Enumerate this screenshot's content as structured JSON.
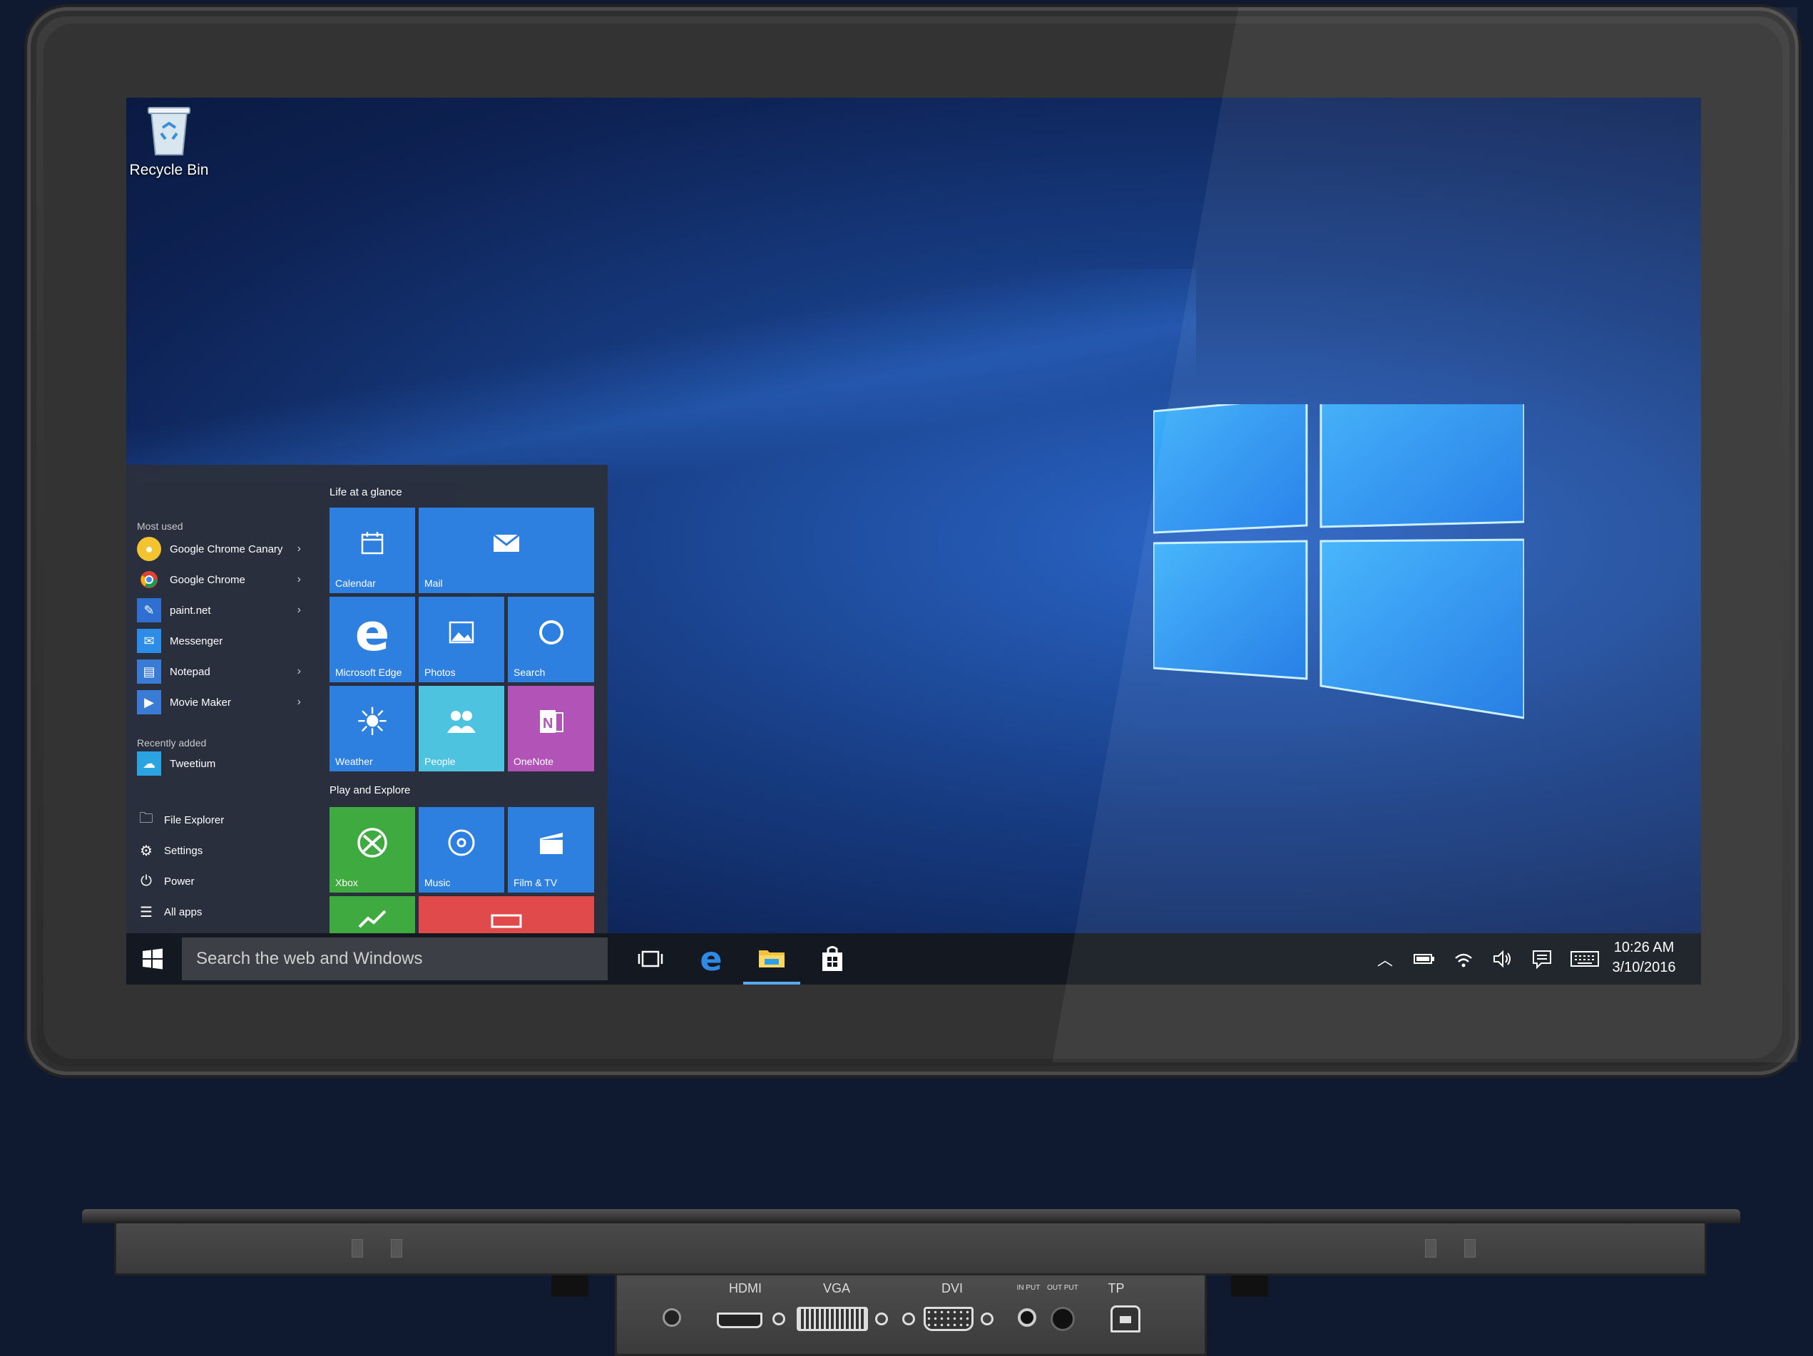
{
  "desktop": {
    "recycle_bin_label": "Recycle Bin"
  },
  "start_menu": {
    "most_used_header": "Most used",
    "most_used": [
      {
        "label": "Google Chrome Canary",
        "icon": "chrome-canary-icon",
        "color": "#f4c430",
        "has_submenu": true
      },
      {
        "label": "Google Chrome",
        "icon": "chrome-icon",
        "color": "#4c8bf5",
        "has_submenu": true
      },
      {
        "label": "paint.net",
        "icon": "paintnet-icon",
        "color": "#2f6fd1",
        "has_submenu": true
      },
      {
        "label": "Messenger",
        "icon": "messenger-icon",
        "color": "#2d8ce8",
        "has_submenu": false
      },
      {
        "label": "Notepad",
        "icon": "notepad-icon",
        "color": "#3a7bd5",
        "has_submenu": true
      },
      {
        "label": "Movie Maker",
        "icon": "movie-maker-icon",
        "color": "#3a7bd5",
        "has_submenu": true
      }
    ],
    "recently_added_header": "Recently added",
    "recently_added": [
      {
        "label": "Tweetium",
        "icon": "tweetium-icon",
        "color": "#2aa3e0"
      }
    ],
    "system_items": [
      {
        "label": "File Explorer",
        "icon": "folder-icon"
      },
      {
        "label": "Settings",
        "icon": "gear-icon"
      },
      {
        "label": "Power",
        "icon": "power-icon"
      },
      {
        "label": "All apps",
        "icon": "list-icon"
      }
    ],
    "life_header": "Life at a glance",
    "play_header": "Play and Explore",
    "tiles": {
      "calendar": "Calendar",
      "mail": "Mail",
      "edge": "Microsoft Edge",
      "photos": "Photos",
      "search": "Search",
      "weather": "Weather",
      "people": "People",
      "onenote": "OneNote",
      "xbox": "Xbox",
      "music": "Music",
      "film": "Film & TV"
    }
  },
  "taskbar": {
    "search_placeholder": "Search the web and Windows",
    "time": "10:26 AM",
    "date": "3/10/2016"
  },
  "io_panel": {
    "hdmi": "HDMI",
    "vga": "VGA",
    "dvi": "DVI",
    "input": "IN PUT",
    "output": "OUT PUT",
    "tp": "TP"
  },
  "colors": {
    "tile_blue": "#2d7fe0",
    "tile_people": "#4ec3e0",
    "tile_onenote": "#b254b7",
    "tile_xbox": "#3faa3f",
    "tile_red": "#e04a4a",
    "taskbar": "#141820",
    "bezel": "#2f2f2f",
    "background": "#0f1a30"
  }
}
